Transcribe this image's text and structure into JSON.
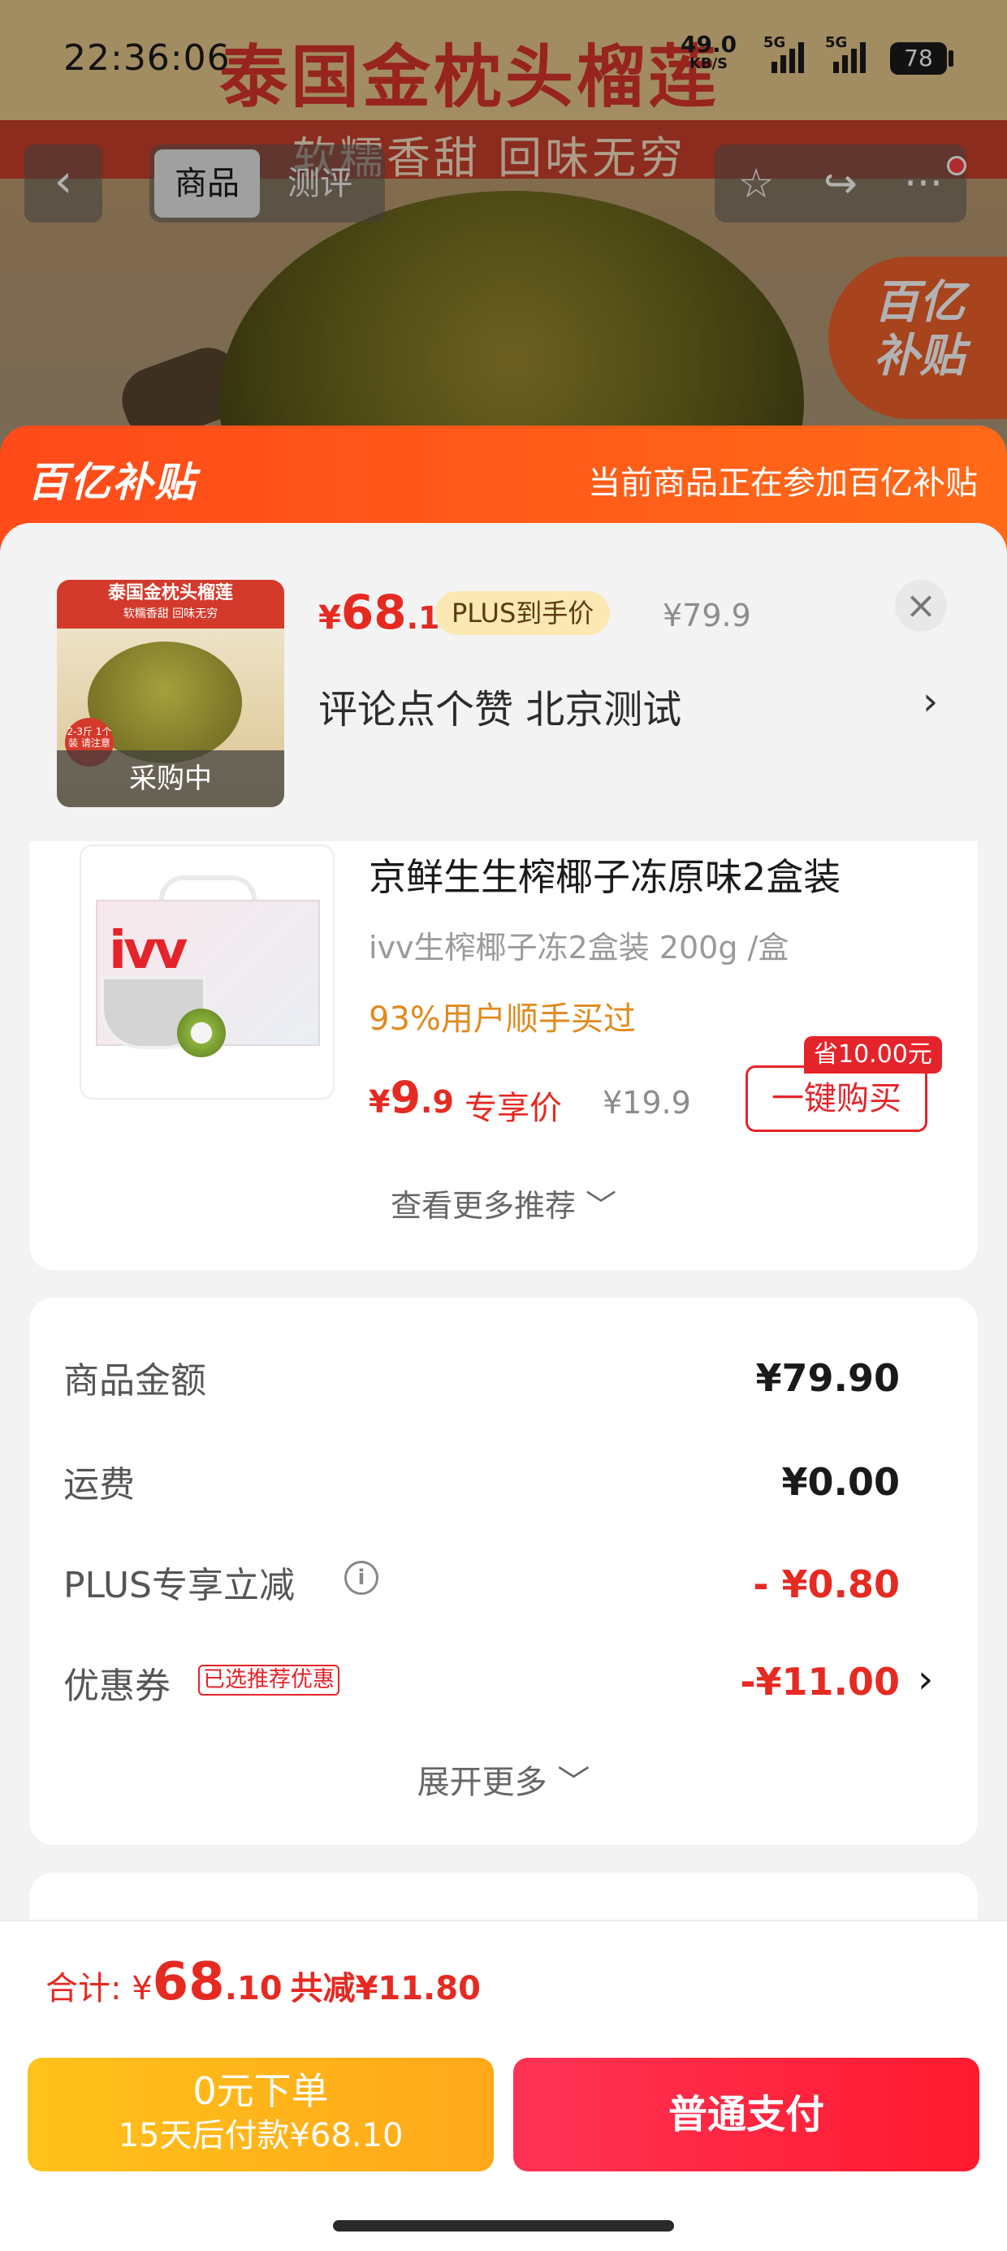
{
  "status_bar": {
    "time": "22:36:06",
    "net_speed": "49.0",
    "net_unit": "KB/S",
    "signal_1": "5G",
    "signal_2": "5G",
    "battery": "78"
  },
  "background": {
    "title": "泰国金枕头榴莲",
    "subtitle": "软糯香甜 回味无穷",
    "subsidy_badge_l1": "百亿",
    "subsidy_badge_l2": "补贴"
  },
  "nav": {
    "back_icon": "‹",
    "tab_goods": "商品",
    "tab_review": "测评",
    "star_icon": "☆",
    "share_icon": "↪",
    "more_icon": "···"
  },
  "sheet": {
    "brand": "百亿补贴",
    "brand_note": "当前商品正在参加百亿补贴"
  },
  "product": {
    "thumb_band": "泰国金枕头榴莲",
    "thumb_band_sub": "软糯香甜 回味无穷",
    "thumb_dot": "2-3斤 1个装 请注意",
    "thumb_status": "采购中",
    "price_yen": "¥",
    "price_int": "68",
    "price_dec": ".1",
    "plus_tag": "PLUS到手价",
    "price_orig": "¥79.9",
    "close_icon": "×",
    "spec": "评论点个赞  北京测试",
    "spec_chevron": "›"
  },
  "recommendation": {
    "box_logo": "ivv",
    "title": "京鲜生生榨椰子冻原味2盒装",
    "spec": "ivv生榨椰子冻2盒装 200g /盒",
    "bought": "93%用户顺手买过",
    "price_yen": "¥",
    "price_int": "9",
    "price_dec": ".9",
    "price_label": "专享价",
    "price_orig": "¥19.9",
    "save_tag": "省10.00元",
    "buy_button": "一键购买",
    "more": "查看更多推荐 ﹀"
  },
  "costs": {
    "goods_label": "商品金额",
    "goods_value": "¥79.90",
    "shipping_label": "运费",
    "shipping_value": "¥0.00",
    "plus_label": "PLUS专享立减",
    "plus_info_icon": "i",
    "plus_value": "- ¥0.80",
    "coupon_label": "优惠券",
    "coupon_tag": "已选推荐优惠",
    "coupon_value": "-¥11.00",
    "coupon_chevron": "›",
    "expand": "展开更多 ﹀"
  },
  "checkout": {
    "total_label": "合计: ¥",
    "total_int": "68",
    "total_dec": ".10",
    "total_reduce": "共减¥11.80",
    "pay_later_l1": "0元下单",
    "pay_later_l2": "15天后付款¥68.10",
    "pay_normal": "普通支付"
  },
  "colors": {
    "accent_red": "#e52a22",
    "subsidy_orange": "#ff5a1a",
    "pay_later_yellow": "#ffb31a",
    "pay_normal_red": "#ff2a40"
  }
}
